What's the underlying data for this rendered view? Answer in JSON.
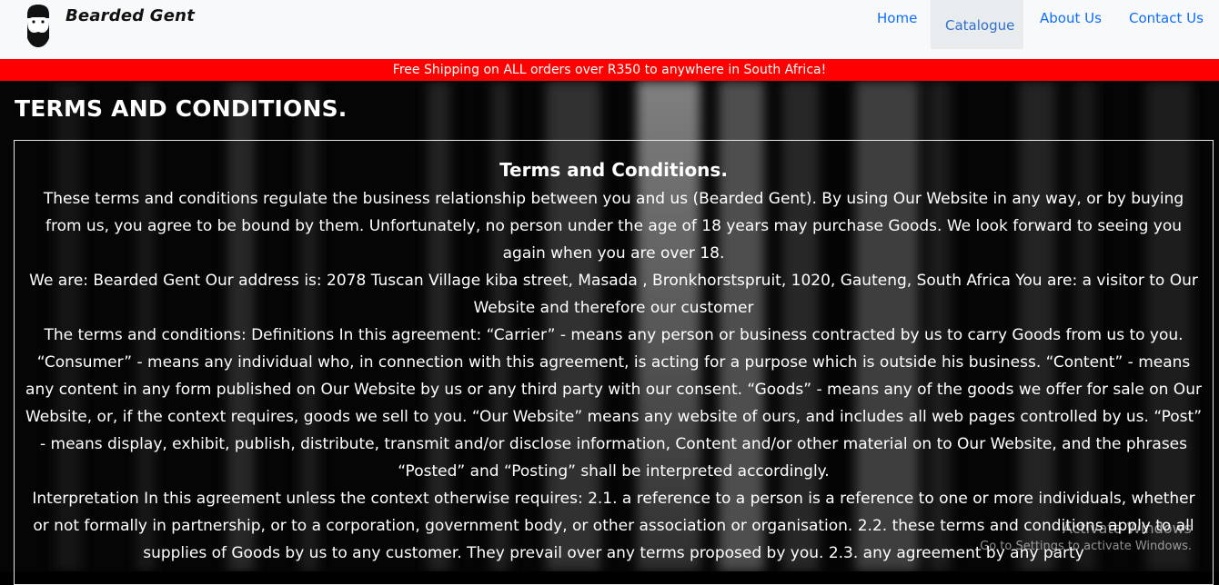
{
  "brand": {
    "name": "Bearded Gent",
    "logo_icon": "bearded-man-icon"
  },
  "nav": {
    "home": "Home",
    "catalogue": "Catalogue",
    "about": "About Us",
    "contact": "Contact Us"
  },
  "promo_banner": "Free Shipping on ALL orders over R350 to anywhere in South Africa!",
  "page_title": "TERMS AND CONDITIONS.",
  "terms": {
    "heading": "Terms and Conditions.",
    "paragraphs": [
      "These terms and conditions regulate the business relationship between you and us (Bearded Gent). By using Our Website in any way, or by buying from us, you agree to be bound by them. Unfortunately, no person under the age of 18 years may purchase Goods. We look forward to seeing you again when you are over 18.",
      "We are: Bearded Gent Our address is: 2078 Tuscan Village kiba street, Masada , Bronkhorstspruit, 1020, Gauteng, South Africa You are: a visitor to Our Website and therefore our customer",
      "The terms and conditions: Definitions In this agreement: “Carrier” - means any person or business contracted by us to carry Goods from us to you. “Consumer” - means any individual who, in connection with this agreement, is acting for a purpose which is outside his business. “Content” - means any content in any form published on Our Website by us or any third party with our consent. “Goods” - means any of the goods we offer for sale on Our Website, or, if the context requires, goods we sell to you. “Our Website” means any website of ours, and includes all web pages controlled by us. “Post” - means display, exhibit, publish, distribute, transmit and/or disclose information, Content and/or other material on to Our Website, and the phrases “Posted” and “Posting” shall be interpreted accordingly.",
      "Interpretation In this agreement unless the context otherwise requires: 2.1. a reference to a person is a reference to one or more individuals, whether or not formally in partnership, or to a corporation, government body, or other association or organisation. 2.2. these terms and conditions apply to all supplies of Goods by us to any customer. They prevail over any terms proposed by you. 2.3. any agreement by any party"
    ]
  },
  "watermark": {
    "title": "Activate Windows",
    "subtitle": "Go to Settings to activate Windows."
  },
  "colors": {
    "nav_link": "#0d6efd",
    "promo_bg": "#ff0000",
    "navbar_bg": "#f8f9fa"
  }
}
